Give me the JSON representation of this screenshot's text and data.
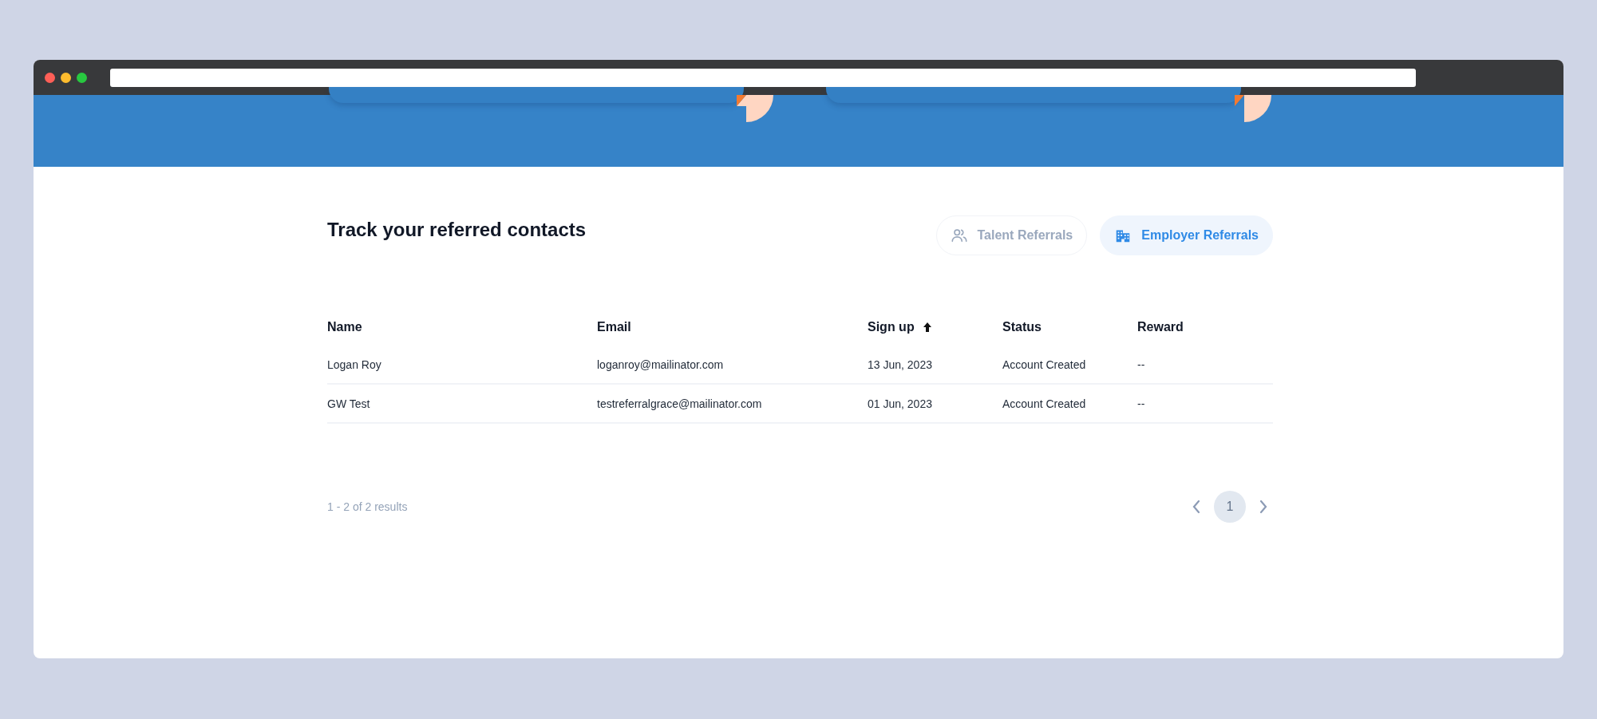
{
  "heading": "Track your referred contacts",
  "tabs": [
    {
      "label": "Talent Referrals",
      "kind": "people",
      "selected": false
    },
    {
      "label": "Employer Referrals",
      "kind": "building",
      "selected": true
    }
  ],
  "table": {
    "columns": [
      {
        "label": "Name",
        "sorted": false
      },
      {
        "label": "Email",
        "sorted": false
      },
      {
        "label": "Sign up",
        "sorted": true
      },
      {
        "label": "Status",
        "sorted": false
      },
      {
        "label": "Reward",
        "sorted": false
      }
    ],
    "rows": [
      [
        "Logan Roy",
        "loganroy@mailinator.com",
        "13 Jun, 2023",
        "Account Created",
        "--"
      ],
      [
        "GW Test",
        "testreferralgrace@mailinator.com",
        "01 Jun, 2023",
        "Account Created",
        "--"
      ]
    ]
  },
  "pagination": {
    "summary": "1 - 2 of 2 results",
    "pages": [
      {
        "label": "1",
        "selected": true
      }
    ]
  }
}
